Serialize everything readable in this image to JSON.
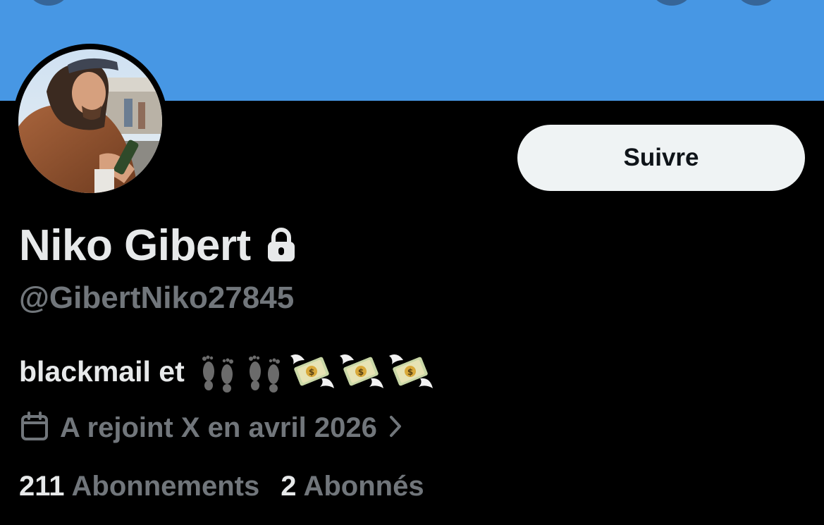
{
  "profile": {
    "display_name": "Niko Gibert",
    "handle": "@GibertNiko27845",
    "bio_text": "blackmail et",
    "bio_emojis": [
      "footprints-emoji",
      "footprints-emoji",
      "money-with-wings-emoji",
      "money-with-wings-emoji",
      "money-with-wings-emoji"
    ],
    "joined": "A rejoint X en avril 2026",
    "following_count": "211",
    "following_label": "Abonnements",
    "followers_count": "2",
    "followers_label": "Abonnés",
    "protected_icon": "lock-icon"
  },
  "actions": {
    "follow_label": "Suivre"
  },
  "colors": {
    "banner": "#4797e4",
    "background": "#000000",
    "primary_text": "#e7e9ea",
    "secondary_text": "#71767b",
    "follow_button_bg": "#eff3f4",
    "follow_button_text": "#0f1419"
  }
}
